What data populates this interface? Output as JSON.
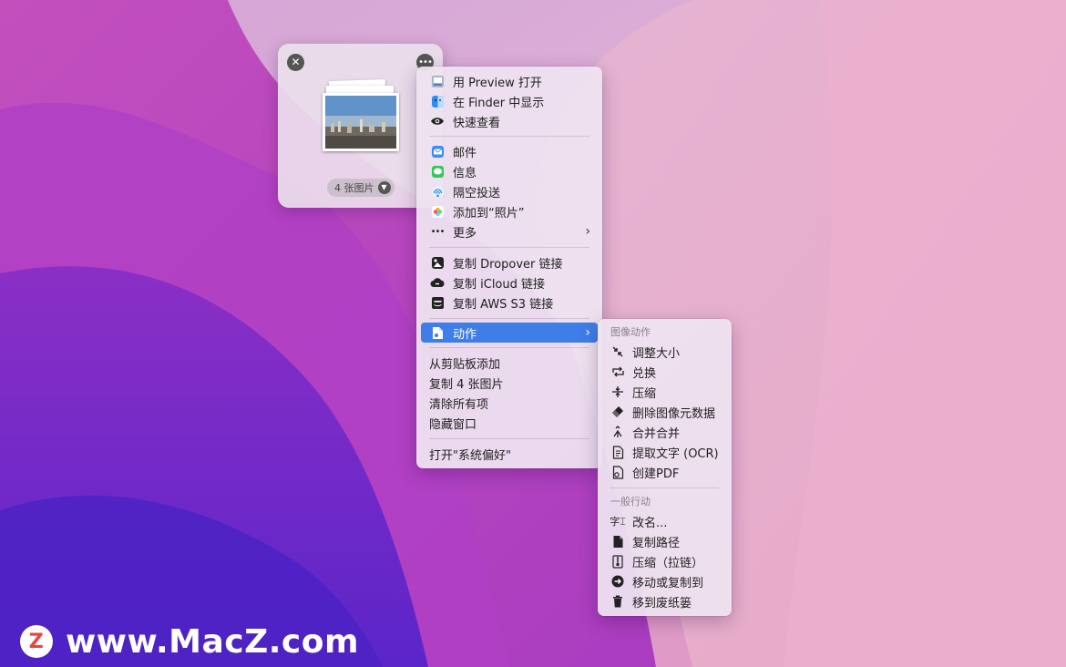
{
  "shelf": {
    "close_icon": "close-icon",
    "more_icon": "ellipsis-icon",
    "count_label": "4 张图片"
  },
  "main_menu": {
    "items": [
      {
        "label": "用 Preview 打开",
        "icon": "preview-app-icon"
      },
      {
        "label": "在 Finder 中显示",
        "icon": "finder-icon"
      },
      {
        "label": "快速查看",
        "icon": "eye-icon"
      },
      {
        "label": "邮件",
        "icon": "mail-icon"
      },
      {
        "label": "信息",
        "icon": "messages-icon"
      },
      {
        "label": "隔空投送",
        "icon": "airdrop-icon"
      },
      {
        "label": "添加到“照片”",
        "icon": "photos-icon"
      },
      {
        "label": "更多",
        "icon": "ellipsis-icon",
        "arrow": "›"
      },
      {
        "label": "复制 Dropover 链接",
        "icon": "dropover-icon"
      },
      {
        "label": "复制 iCloud 链接",
        "icon": "icloud-link-icon"
      },
      {
        "label": "复制 AWS S3 链接",
        "icon": "aws-icon"
      },
      {
        "label": "动作",
        "icon": "action-document-icon",
        "arrow": "›",
        "highlighted": true
      },
      {
        "label": "从剪贴板添加"
      },
      {
        "label": "复制 4 张图片"
      },
      {
        "label": "清除所有项"
      },
      {
        "label": "隐藏窗口"
      },
      {
        "label": "打开\"系统偏好\""
      }
    ]
  },
  "sub_menu": {
    "image_actions_title": "图像动作",
    "general_actions_title": "一般行动",
    "image_items": [
      {
        "label": "调整大小",
        "icon": "resize-icon"
      },
      {
        "label": "兑换",
        "icon": "convert-icon"
      },
      {
        "label": "压缩",
        "icon": "compress-icon"
      },
      {
        "label": "删除图像元数据",
        "icon": "eraser-icon"
      },
      {
        "label": "合并合并",
        "icon": "merge-icon"
      },
      {
        "label": "提取文字 (OCR)",
        "icon": "ocr-icon"
      },
      {
        "label": "创建PDF",
        "icon": "pdf-icon"
      }
    ],
    "general_items": [
      {
        "label": "改名...",
        "icon": "rename-icon"
      },
      {
        "label": "复制路径",
        "icon": "copy-path-icon"
      },
      {
        "label": "压缩（拉链）",
        "icon": "zip-icon"
      },
      {
        "label": "移动或复制到",
        "icon": "arrow-circle-icon"
      },
      {
        "label": "移到废纸篓",
        "icon": "trash-icon"
      }
    ]
  },
  "watermark": {
    "text": "www.MacZ.com",
    "logo_letter": "Z"
  },
  "colors": {
    "highlight": "#3f7ee8",
    "menu_bg": "#eee2f0",
    "watermark_logo": "#e8453c"
  }
}
